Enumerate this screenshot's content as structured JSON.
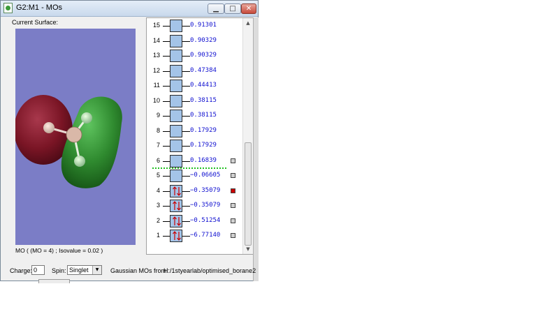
{
  "window": {
    "title": "G2:M1 - MOs"
  },
  "left": {
    "surface_label": "Current Surface:",
    "mo_caption": "MO ( (MO = 4) ; Isovalue = 0.02 )"
  },
  "orbitals": [
    {
      "num": "15",
      "energy": "0.91301",
      "occupied": false,
      "checkbox": false,
      "selected": false
    },
    {
      "num": "14",
      "energy": "0.90329",
      "occupied": false,
      "checkbox": false,
      "selected": false
    },
    {
      "num": "13",
      "energy": "0.90329",
      "occupied": false,
      "checkbox": false,
      "selected": false
    },
    {
      "num": "12",
      "energy": "0.47384",
      "occupied": false,
      "checkbox": false,
      "selected": false
    },
    {
      "num": "11",
      "energy": "0.44413",
      "occupied": false,
      "checkbox": false,
      "selected": false
    },
    {
      "num": "10",
      "energy": "0.38115",
      "occupied": false,
      "checkbox": false,
      "selected": false
    },
    {
      "num": "9",
      "energy": "0.38115",
      "occupied": false,
      "checkbox": false,
      "selected": false
    },
    {
      "num": "8",
      "energy": "0.17929",
      "occupied": false,
      "checkbox": false,
      "selected": false
    },
    {
      "num": "7",
      "energy": "0.17929",
      "occupied": false,
      "checkbox": false,
      "selected": false
    },
    {
      "num": "6",
      "energy": "0.16839",
      "occupied": false,
      "checkbox": true,
      "selected": false
    },
    {
      "num": "5",
      "energy": "−0.06605",
      "occupied": false,
      "checkbox": true,
      "selected": false
    },
    {
      "num": "4",
      "energy": "−0.35079",
      "occupied": true,
      "checkbox": true,
      "selected": true
    },
    {
      "num": "3",
      "energy": "−0.35079",
      "occupied": true,
      "checkbox": true,
      "selected": false
    },
    {
      "num": "2",
      "energy": "−0.51254",
      "occupied": true,
      "checkbox": true,
      "selected": false
    },
    {
      "num": "1",
      "energy": "−6.77140",
      "occupied": true,
      "checkbox": true,
      "selected": false
    }
  ],
  "bottom": {
    "charge_label": "Charge:",
    "charge_value": "0",
    "spin_label": "Spin:",
    "spin_value": "Singlet",
    "source_label": "Gaussian MOs from:",
    "source_path": "H:/1styearlab/optimised_borane2"
  },
  "colors": {
    "viewport_bg": "#7b7dc6",
    "positive_lobe": "#2f8a2f",
    "negative_lobe": "#7a1525",
    "energy_text": "#1010d0",
    "occupied_arrow": "#cc0000",
    "homo_lumo_divider": "#1fbf1f",
    "selected_checkbox": "#cc0000"
  },
  "icons": {
    "app": "gaussview-icon",
    "minimize": "minimize-icon",
    "maximize": "maximize-icon",
    "close": "close-icon"
  }
}
